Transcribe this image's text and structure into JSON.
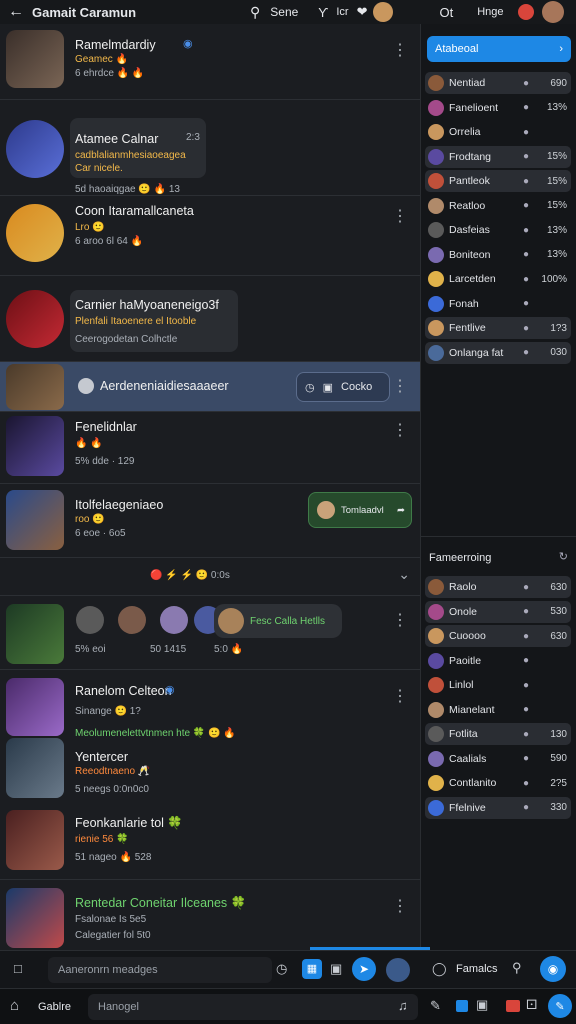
{
  "topbar": {
    "title": "Gamait Caramun",
    "search": "Sene",
    "btn1": "Ƴ",
    "btn2": "Icr",
    "right_label": "Ot",
    "right_link": "Hnge"
  },
  "rows": [
    {
      "name": "Ramelmdardiy",
      "sub": "Geamec 🔥",
      "sub2": "6 ehrdce 🔥 🔥"
    },
    {
      "name": "Atamee Calnar",
      "time": "2:3",
      "msg": "cadblalianmhesiaoeagea",
      "msg2": "Car nicele.",
      "sub": "5d haoaiqgae 🙂 🔥 13"
    },
    {
      "name": "Coon Itaramallcaneta",
      "sub": "Lro 🙂",
      "sub2": "6 aroo  6l 64 🔥"
    },
    {
      "name": "Carnier haMyoaneneigo3f",
      "msg": "Plenfali Itaoenere el Itooble",
      "sub": "Ceerogodetan Colhctle"
    },
    {
      "name": "Aerdeneniaidiesaaaeer",
      "pill": "Cocko"
    },
    {
      "name": "Fenelidnlar",
      "sub": "🔥 🔥",
      "sub2": "5% dde · 129"
    },
    {
      "name": "Itolfelaegeniaeo",
      "sub": "roo 🙂",
      "sub2": "6 eoe · 6o5",
      "card": "Tomlaadvl"
    },
    {
      "group": "🔴 ⚡ ⚡ 🙂 0:0s"
    },
    {
      "chip": "Fesc Calla Hetlls",
      "s1": "5% eoi",
      "s2": "50 1415",
      "s3": "5:0 🔥"
    },
    {
      "name": "Ranelom Celteon",
      "sub": "Sinange 🙂 1?",
      "msg": "Meolumenelettvtnmen hte 🍀 🙂 🔥"
    },
    {
      "name": "Yentercer",
      "msg": "Reeodtnaeno 🥂",
      "sub": "5 neegs  0:0n0c0"
    },
    {
      "name": "Feonkanlarie tol 🍀",
      "msg": "rienie 56 🍀",
      "sub": "51 nageo 🔥 528"
    },
    {
      "name": "Rentedar Coneitar Ilceanes 🍀",
      "sub": "Fsalonae Is 5e5",
      "sub2": "Calegatier  fol 5t0"
    }
  ],
  "right": {
    "header": "Atabeoal",
    "items": [
      {
        "label": "Nentiad",
        "val": "690"
      },
      {
        "label": "Fanelioent",
        "val": "13%"
      },
      {
        "label": "Orrelia",
        "val": ""
      },
      {
        "label": "Frodtang",
        "val": "15%"
      },
      {
        "label": "Pantleok",
        "val": "15%"
      },
      {
        "label": "Reatloo",
        "val": "15%"
      },
      {
        "label": "Dasfeias",
        "val": "13%"
      },
      {
        "label": "Boniteon",
        "val": "13%"
      },
      {
        "label": "Larcetden",
        "val": "100%"
      },
      {
        "label": "Fonah",
        "val": ""
      },
      {
        "label": "Fentlive",
        "val": "1?3"
      },
      {
        "label": "Onlanga fat",
        "val": "030"
      }
    ],
    "section2": "Fameerroing",
    "items2": [
      {
        "label": "Raolo",
        "val": "630"
      },
      {
        "label": "Onole",
        "val": "530"
      },
      {
        "label": "Cuoooo",
        "val": "630"
      },
      {
        "label": "Paoitle",
        "val": ""
      },
      {
        "label": "Linlol",
        "val": ""
      },
      {
        "label": "Mianelant",
        "val": ""
      },
      {
        "label": "Fotlita",
        "val": "130"
      },
      {
        "label": "Caalials",
        "val": "590"
      },
      {
        "label": "Contlanito",
        "val": "2?5"
      },
      {
        "label": "Ffelnive",
        "val": "330"
      }
    ]
  },
  "composer": {
    "placeholder": "Aaneronrn meadges",
    "right_label": "Famalcs"
  },
  "bottombar": {
    "label": "Gablre",
    "input": "Hanogel"
  },
  "colors": {
    "accent": "#1e88e5",
    "panel": "#141619",
    "bg": "#1b1d21"
  }
}
